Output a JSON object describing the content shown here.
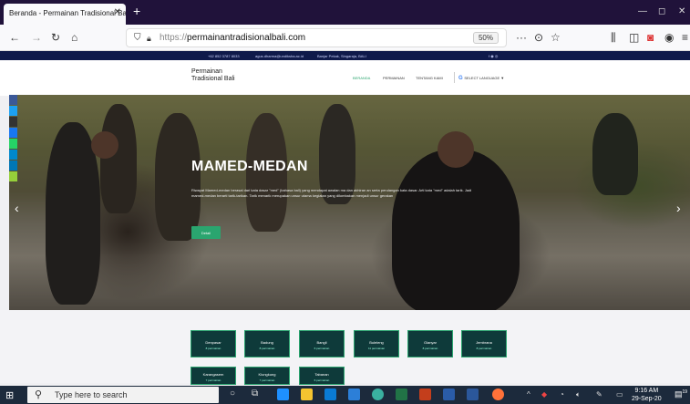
{
  "browser": {
    "tab_title": "Beranda - Permainan Tradisional Ba",
    "tab_close": "✕",
    "new_tab": "+",
    "url_https": "https://",
    "url_domain": "permainantradisionalbali.com",
    "zoom": "50%",
    "menu_dots": "···"
  },
  "site": {
    "infobar": {
      "phone": "+62 852 3787 8033",
      "email": "agus.dharma@undiksha.ac.id",
      "address": "Banjar Pekak, Singaraja, BALI",
      "social": "f  ◉  ◎"
    },
    "logo_line1": "Permainan",
    "logo_line2": "Tradisional Bali",
    "nav": [
      "BERANDA",
      "PERMAINAN",
      "TENTANG KAMI"
    ],
    "language": "SELECT LANGUAGE  ▼"
  },
  "hero": {
    "title": "MAMED-MEDAN",
    "description": "Riwayat Mamed-medan berasal dari kata dasar \"med\" (bahasa bali) yang mendapat awalan ma dan akhiran an serta perulangan kata dasar. Arti kata \"med\" adalah tarik. Jadi mamed-medan berarti tarik-tarikan. Tarik menarik merupakan unsur utama kegiatan yang dilombakan menjadi unsur gerakan",
    "button": "Detail",
    "prev": "‹",
    "next": "›"
  },
  "tiles": [
    {
      "name": "Denpasar",
      "sub": "8 permainan"
    },
    {
      "name": "Badung",
      "sub": "8 permainan"
    },
    {
      "name": "Bangli",
      "sub": "6 permainan"
    },
    {
      "name": "Buleleng",
      "sub": "11 permainan"
    },
    {
      "name": "Gianyar",
      "sub": "8 permainan"
    },
    {
      "name": "Jembrana",
      "sub": "8 permainan"
    },
    {
      "name": "Karangasem",
      "sub": "7 permainan"
    },
    {
      "name": "Klungkung",
      "sub": "7 permainan"
    },
    {
      "name": "Tabanan",
      "sub": "6 permainan"
    }
  ],
  "taskbar": {
    "search_placeholder": "Type here to search",
    "time": "9:16 AM",
    "date": "29-Sep-20",
    "notifications": "19"
  },
  "colors": {
    "accent": "#2aa56f",
    "titlebar": "#20123a",
    "taskbar": "#1c2a3c"
  }
}
